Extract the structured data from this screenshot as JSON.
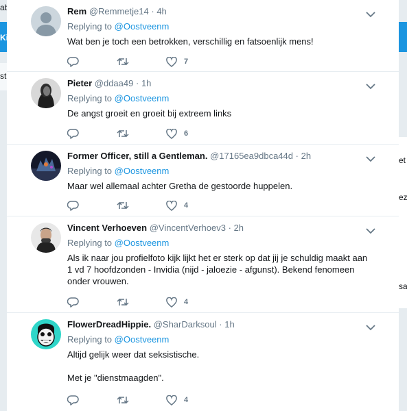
{
  "background": {
    "left_fragments": [
      "ab",
      "Ki",
      "st"
    ],
    "right_fragments": [
      "et",
      "ez",
      "sa"
    ]
  },
  "tweets": [
    {
      "name": "Rem",
      "handle": "@Remmetje14",
      "time": "4h",
      "reply_prefix": "Replying to",
      "reply_to": "@Oostveenm",
      "lines": [
        "Wat ben je toch een betrokken, verschillig en fatsoenlijk mens!"
      ],
      "likes": "7",
      "avatar": "default"
    },
    {
      "name": "Pieter",
      "handle": "@ddaa49",
      "time": "1h",
      "reply_prefix": "Replying to",
      "reply_to": "@Oostveenm",
      "lines": [
        "De angst groeit en groeit bij extreem links"
      ],
      "likes": "6",
      "avatar": "photo-dark"
    },
    {
      "name": "Former Officer, still a Gentleman.",
      "handle": "@17165ea9dbca44d",
      "time": "2h",
      "reply_prefix": "Replying to",
      "reply_to": "@Oostveenm",
      "lines": [
        "Maar wel allemaal achter Gretha de gestoorde huppelen."
      ],
      "likes": "4",
      "avatar": "photo-night"
    },
    {
      "name": "Vincent Verhoeven",
      "handle": "@VincentVerhoev3",
      "time": "2h",
      "reply_prefix": "Replying to",
      "reply_to": "@Oostveenm",
      "lines": [
        "Als ik naar jou profielfoto kijk lijkt het er sterk op dat jij je schuldig maakt aan",
        "1 vd 7 hoofdzonden - Invidia (nijd - jaloezie - afgunst). Bekend fenomeen",
        "onder vrouwen."
      ],
      "likes": "4",
      "avatar": "photo-man"
    },
    {
      "name": "FlowerDreadHippie.",
      "handle": "@SharDarksoul",
      "time": "1h",
      "reply_prefix": "Replying to",
      "reply_to": "@Oostveenm",
      "lines": [
        "Altijd gelijk weer dat seksistische.",
        "",
        "Met je \"dienstmaagden\"."
      ],
      "likes": "4",
      "avatar": "cartoon"
    }
  ],
  "icons": {
    "reply": "reply-icon",
    "retweet": "retweet-icon",
    "like": "heart-icon",
    "more": "chevron-down-icon"
  },
  "colors": {
    "link": "#1b95e0",
    "muted": "#657786",
    "text": "#14171a",
    "divider": "#e6ecf0"
  }
}
